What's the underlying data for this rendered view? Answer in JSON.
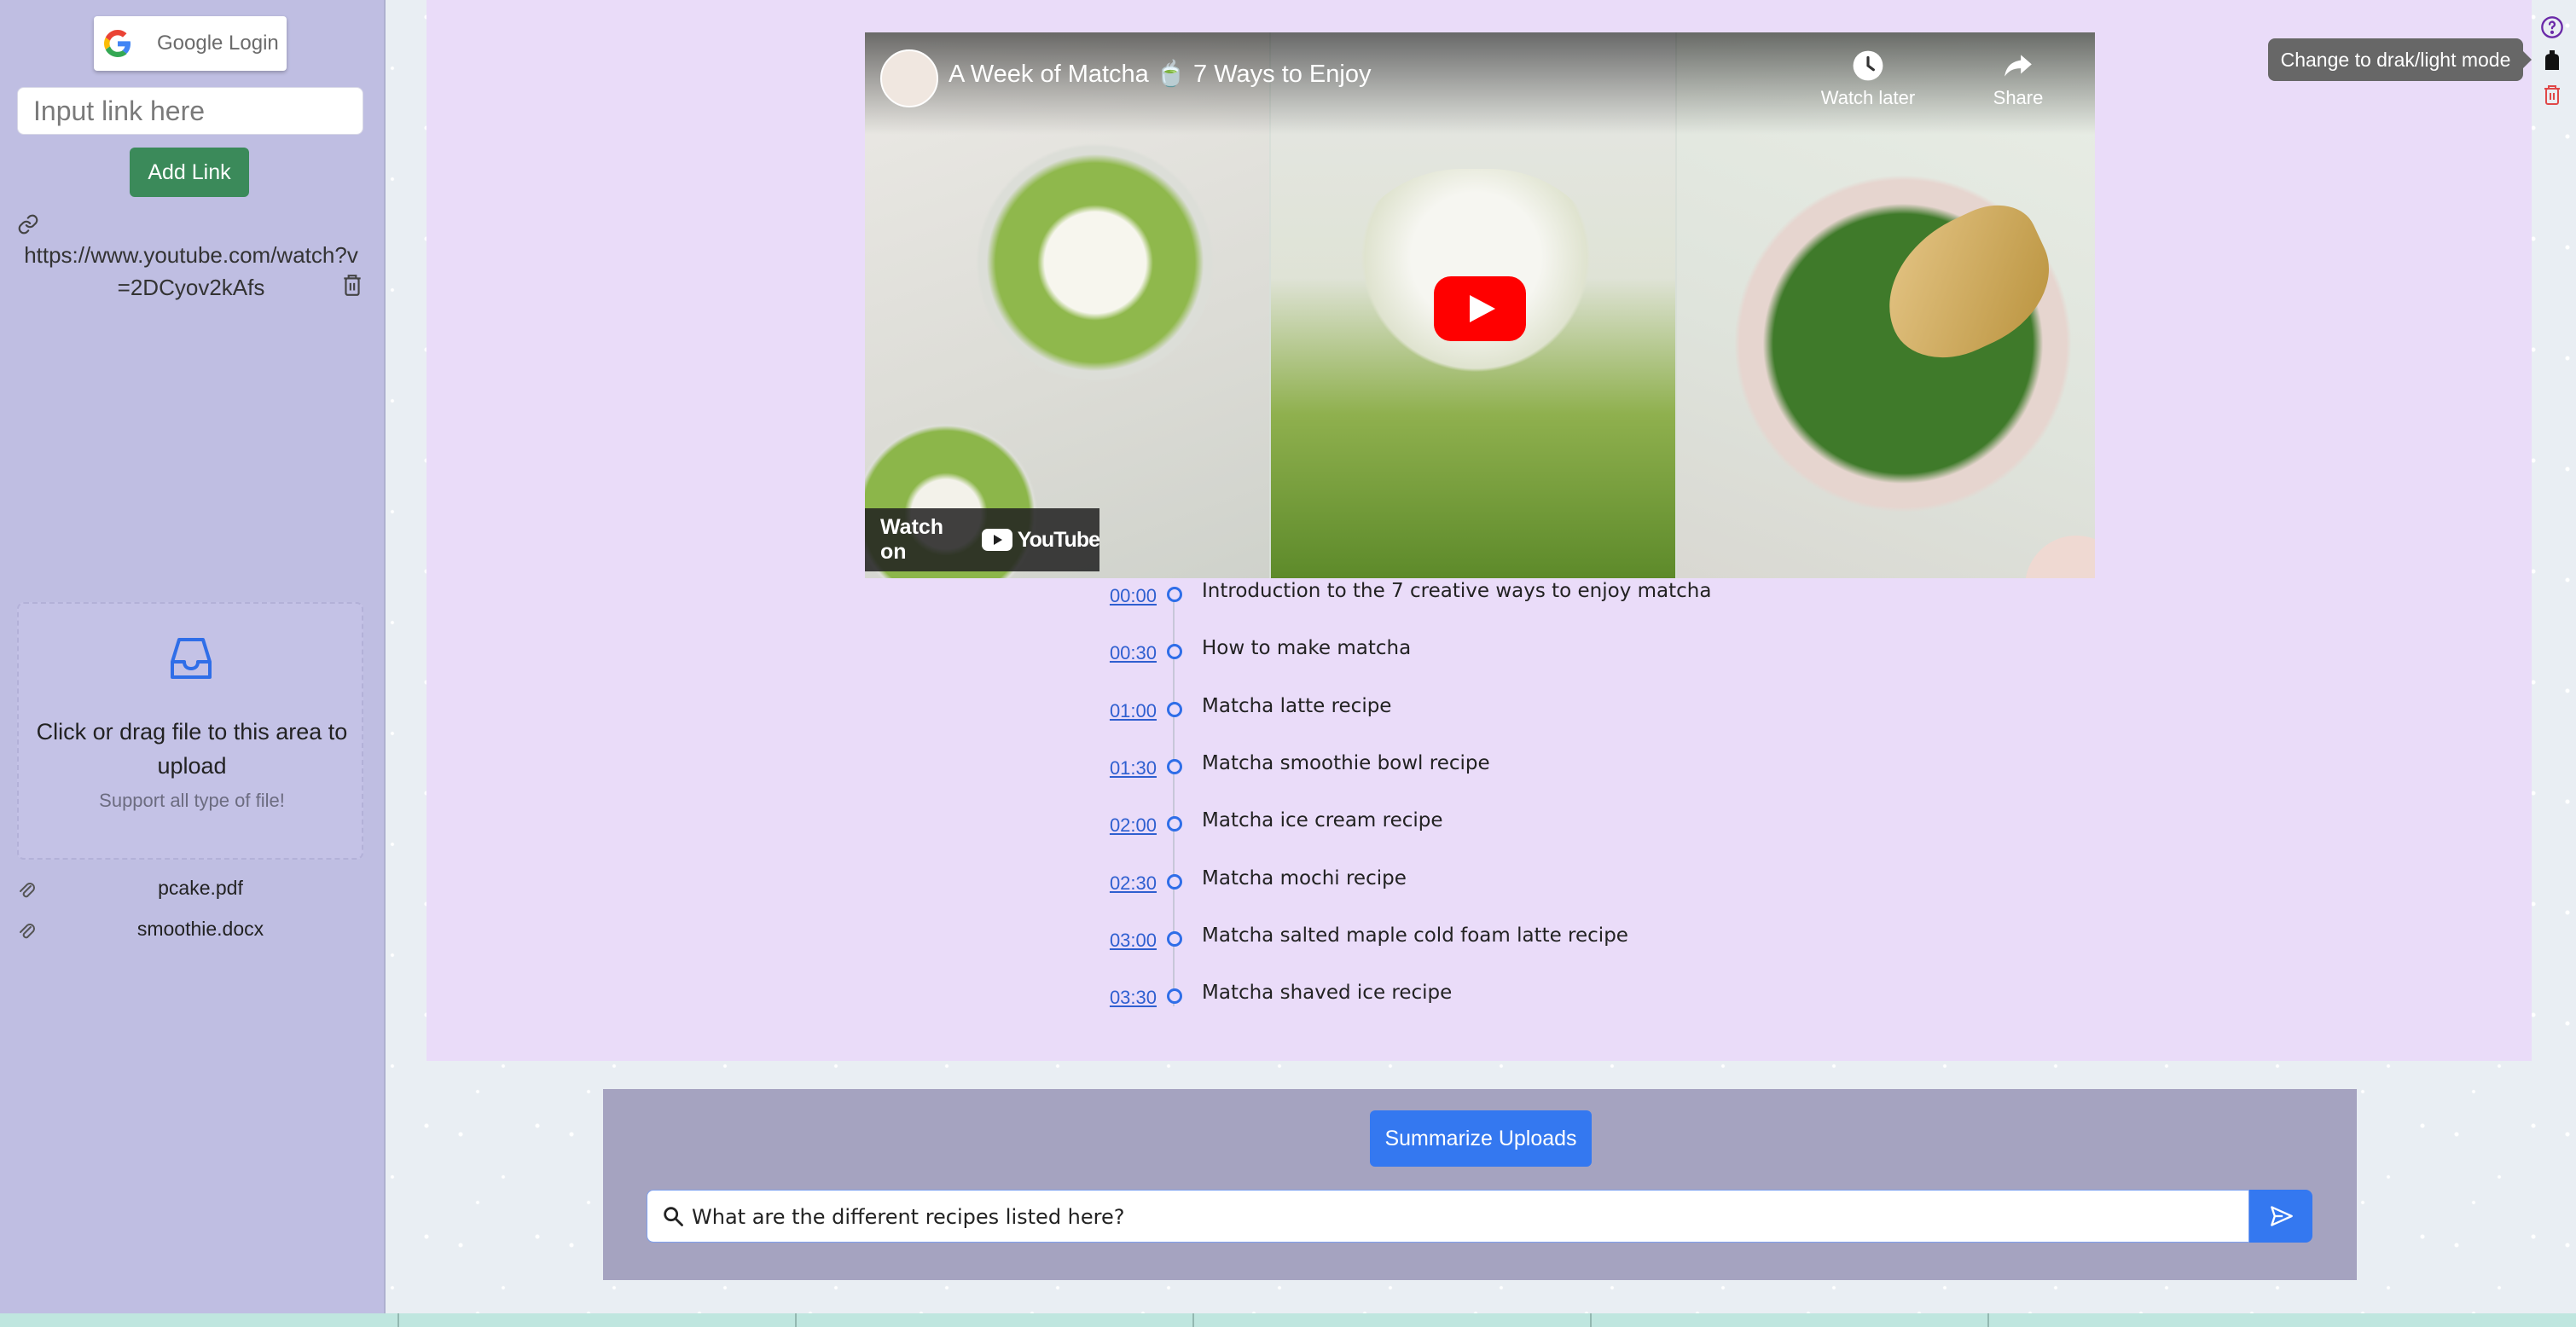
{
  "sidebar": {
    "google_login_label": "Google Login",
    "link_input_placeholder": "Input link here",
    "add_link_label": "Add Link",
    "links": [
      {
        "url": "https://www.youtube.com/watch?v=2DCyov2kAfs"
      }
    ],
    "upload": {
      "text": "Click or drag file to this area to upload",
      "hint": "Support all type of file!"
    },
    "files": [
      {
        "name": "pcake.pdf"
      },
      {
        "name": "smoothie.docx"
      }
    ]
  },
  "video": {
    "title": "A Week of Matcha 🍵 7 Ways to Enjoy",
    "watch_later_label": "Watch later",
    "share_label": "Share",
    "watch_on_label": "Watch on",
    "youtube_wordmark": "YouTube"
  },
  "timeline": [
    {
      "time": "00:00",
      "text": "Introduction to the 7 creative ways to enjoy matcha"
    },
    {
      "time": "00:30",
      "text": "How to make matcha"
    },
    {
      "time": "01:00",
      "text": "Matcha latte recipe"
    },
    {
      "time": "01:30",
      "text": "Matcha smoothie bowl recipe"
    },
    {
      "time": "02:00",
      "text": "Matcha ice cream recipe"
    },
    {
      "time": "02:30",
      "text": "Matcha mochi recipe"
    },
    {
      "time": "03:00",
      "text": "Matcha salted maple cold foam latte recipe"
    },
    {
      "time": "03:30",
      "text": "Matcha shaved ice recipe"
    }
  ],
  "chat": {
    "summarize_label": "Summarize Uploads",
    "query_value": "What are the different recipes listed here?"
  },
  "right_rail": {
    "tooltip": "Change to drak/light mode",
    "icons": [
      "help-icon",
      "theme-icon",
      "trash-icon"
    ]
  },
  "colors": {
    "sidebar_bg": "#bfbee2",
    "main_bg": "#eadcf9",
    "chat_bg": "#a5a3c0",
    "accent_blue": "#3478f0",
    "add_link_green": "#3b8a5a",
    "timeline_dot": "#2f6ee8"
  }
}
